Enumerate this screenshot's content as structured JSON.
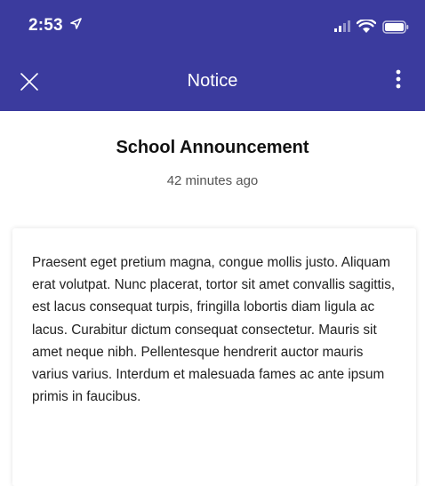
{
  "status_bar": {
    "time": "2:53",
    "icons": [
      "location-arrow-icon",
      "signal-icon",
      "wifi-icon",
      "battery-icon"
    ]
  },
  "nav": {
    "title": "Notice",
    "close_icon": "close-icon",
    "more_icon": "more-vertical-icon"
  },
  "announcement": {
    "title": "School Announcement",
    "time": "42 minutes ago",
    "body": "Praesent eget pretium magna, congue mollis justo. Aliquam erat volutpat. Nunc placerat, tortor sit amet convallis sagittis, est lacus consequat turpis, fringilla lobortis diam ligula ac lacus. Curabitur dictum consequat consectetur. Mauris sit amet neque nibh. Pellentesque hendrerit auctor mauris varius varius. Interdum et malesuada fames ac ante ipsum primis in faucibus."
  },
  "colors": {
    "header": "#3b3b9e",
    "header_text": "#ffffff",
    "background": "#ffffff"
  }
}
